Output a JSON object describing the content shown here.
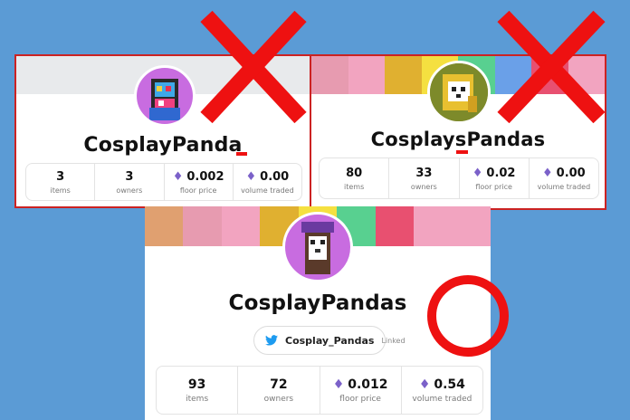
{
  "cards": [
    {
      "id": "card1",
      "name": "CosplayPanda",
      "stats": [
        {
          "value": "3",
          "label": "items",
          "eth": false
        },
        {
          "value": "3",
          "label": "owners",
          "eth": false
        },
        {
          "value": "0.002",
          "label": "floor price",
          "eth": true
        },
        {
          "value": "0.00",
          "label": "volume traded",
          "eth": true
        }
      ],
      "verdict": "cross"
    },
    {
      "id": "card2",
      "name": "CosplaysPandas",
      "stats": [
        {
          "value": "80",
          "label": "items",
          "eth": false
        },
        {
          "value": "33",
          "label": "owners",
          "eth": false
        },
        {
          "value": "0.02",
          "label": "floor price",
          "eth": true
        },
        {
          "value": "0.00",
          "label": "volume traded",
          "eth": true
        }
      ],
      "verdict": "cross"
    },
    {
      "id": "card3",
      "name": "CosplayPandas",
      "twitter": {
        "handle": "Cosplay_Pandas",
        "status": "Linked"
      },
      "stats": [
        {
          "value": "93",
          "label": "items",
          "eth": false
        },
        {
          "value": "72",
          "label": "owners",
          "eth": false
        },
        {
          "value": "0.012",
          "label": "floor price",
          "eth": true
        },
        {
          "value": "0.54",
          "label": "volume traded",
          "eth": true
        }
      ],
      "verdict": "circle"
    }
  ],
  "icons": {
    "eth": "ethereum-icon",
    "twitter": "twitter-bird-icon"
  },
  "colors": {
    "background": "#5b9bd5",
    "mark": "#ee1111",
    "eth": "#7b61c9",
    "twitter": "#1d9bf0"
  }
}
